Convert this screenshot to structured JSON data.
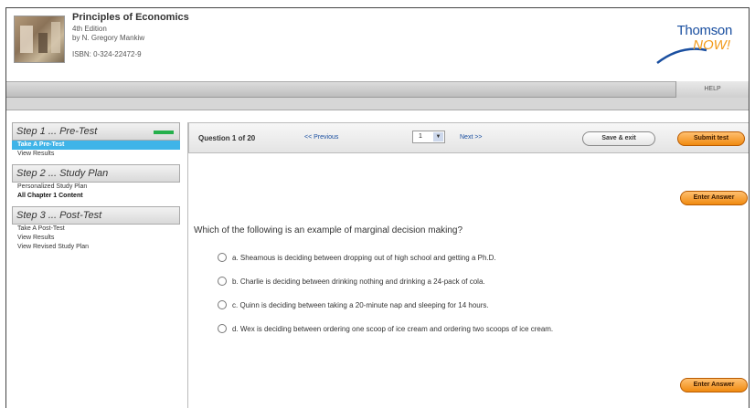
{
  "book": {
    "title": "Principles of Economics",
    "edition": "4th Edition",
    "author": "by N. Gregory Mankiw",
    "isbn": "ISBN: 0-324-22472-9"
  },
  "logo": {
    "line1": "Thomson",
    "line2": "NOW!"
  },
  "header": {
    "help_label": "HELP"
  },
  "sidebar": {
    "steps": [
      {
        "label": "Step 1 ... Pre-Test",
        "links": [
          "Take A Pre-Test",
          "View Results"
        ]
      },
      {
        "label": "Step 2 ... Study Plan",
        "links": [
          "Personalized Study Plan",
          "All Chapter 1 Content"
        ]
      },
      {
        "label": "Step 3 ... Post-Test",
        "links": [
          "Take A Post-Test",
          "View Results",
          "View Revised Study Plan"
        ]
      }
    ]
  },
  "quiz": {
    "counter": "Question 1 of 20",
    "previous_label": "<< Previous",
    "selected_question": "1",
    "next_label": "Next >>",
    "save_exit_label": "Save & exit",
    "submit_label": "Submit test",
    "enter_answer_label": "Enter Answer",
    "question": "Which of the following is an example of marginal decision making?",
    "options": [
      "a. Sheamous is deciding between dropping out of high school and getting a Ph.D.",
      "b. Charlie is deciding between drinking nothing and drinking a 24-pack of cola.",
      "c. Quinn is deciding between taking a 20-minute nap and sleeping for 14 hours.",
      "d. Wex is deciding between ordering one scoop of ice cream and ordering two scoops of ice cream."
    ]
  },
  "colors": {
    "accent_orange": "#f08a10",
    "active_blue": "#3fb4e8",
    "link_blue": "#1a4fa0",
    "step_indicator": "#25b04c"
  }
}
